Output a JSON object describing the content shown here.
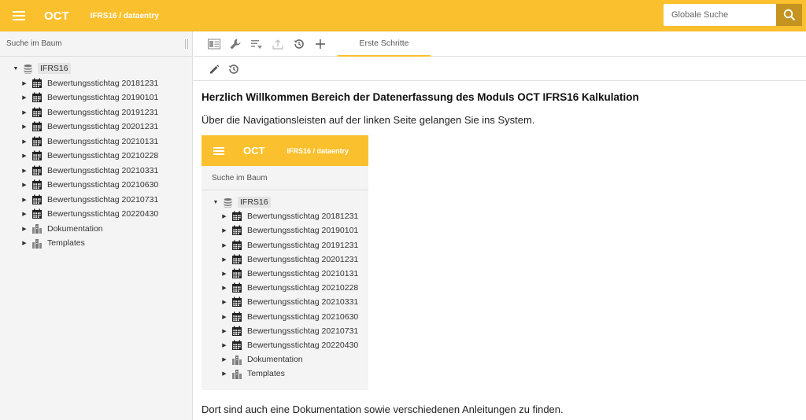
{
  "header": {
    "brand": "OCT",
    "breadcrumb": "IFRS16 / dataentry",
    "search_placeholder": "Globale Suche"
  },
  "sidebar": {
    "search_label": "Suche im Baum"
  },
  "tree": {
    "root": "IFRS16",
    "items": [
      {
        "label": "Bewertungsstichtag 20181231",
        "icon": "calendar-icon"
      },
      {
        "label": "Bewertungsstichtag 20190101",
        "icon": "calendar-icon"
      },
      {
        "label": "Bewertungsstichtag 20191231",
        "icon": "calendar-icon"
      },
      {
        "label": "Bewertungsstichtag 20201231",
        "icon": "calendar-icon"
      },
      {
        "label": "Bewertungsstichtag 20210131",
        "icon": "calendar-icon"
      },
      {
        "label": "Bewertungsstichtag 20210228",
        "icon": "calendar-icon"
      },
      {
        "label": "Bewertungsstichtag 20210331",
        "icon": "calendar-icon"
      },
      {
        "label": "Bewertungsstichtag 20210630",
        "icon": "calendar-icon"
      },
      {
        "label": "Bewertungsstichtag 20210731",
        "icon": "calendar-icon"
      },
      {
        "label": "Bewertungsstichtag 20220430",
        "icon": "calendar-icon"
      },
      {
        "label": "Dokumentation",
        "icon": "city-icon"
      },
      {
        "label": "Templates",
        "icon": "city-icon"
      }
    ]
  },
  "toolbar": {
    "tab_label": "Erste Schritte"
  },
  "content": {
    "heading": "Herzlich Willkommen Bereich der Datenerfassung des Moduls OCT IFRS16 Kalkulation",
    "intro": "Über die Navigationsleisten auf der linken Seite gelangen Sie ins System.",
    "outro": "Dort sind auch eine Dokumentation sowie verschiedenen Anleitungen zu finden."
  },
  "colors": {
    "accent": "#fbc02d",
    "search_button": "#c49320"
  }
}
